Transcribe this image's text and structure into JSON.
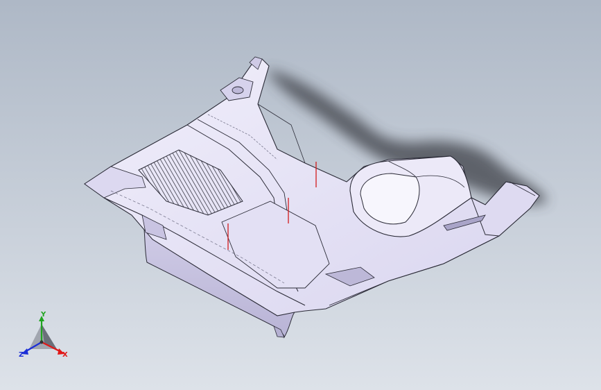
{
  "viewport": {
    "background_top": "#aeb8c6",
    "background_bottom": "#dde2e9"
  },
  "model": {
    "surface_color": "#e6e3f7",
    "edge_color": "#2a2a36",
    "dimension_line_color": "#d21b1b",
    "shadow_color": "#3c4046"
  },
  "triad": {
    "x_label": "X",
    "y_label": "Y",
    "z_label": "Z",
    "x_color": "#e01818",
    "y_color": "#1fa51f",
    "z_color": "#1c2fd6"
  }
}
